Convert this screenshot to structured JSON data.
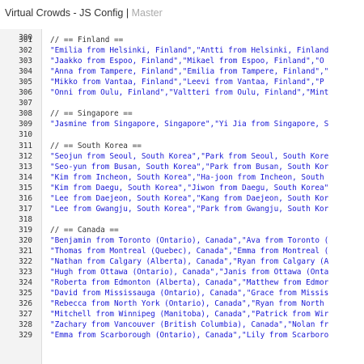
{
  "window": {
    "title": "Virtual Crowds - JS Config",
    "separator": "|",
    "branch": "Master"
  },
  "editor": {
    "partial_line_number": "300",
    "lines": [
      {
        "n": "301",
        "text": "// == Finland ==",
        "kind": "comment"
      },
      {
        "n": "302",
        "text": "\"Emilia from Helsinki, Finland\",\"Antti from Helsinki, Finland",
        "kind": "string"
      },
      {
        "n": "303",
        "text": "\"Jaakko from Espoo, Finland\",\"Mikael from Espoo, Finland\",\"O",
        "kind": "string"
      },
      {
        "n": "304",
        "text": "\"Anna from Tampere, Finland\",\"Emilia from Tampere, Finland\",\"",
        "kind": "string"
      },
      {
        "n": "305",
        "text": "\"Mikko from Vantaa, Finland\",\"Leevi from Vantaa, Finland\",\"P",
        "kind": "string"
      },
      {
        "n": "306",
        "text": "\"Onni from Oulu, Finland\",\"Valtteri from Oulu, Finland\",\"Mint",
        "kind": "string"
      },
      {
        "n": "307",
        "text": "",
        "kind": "blank"
      },
      {
        "n": "308",
        "text": "// == Singapore ==",
        "kind": "comment"
      },
      {
        "n": "309",
        "text": "\"Jasmine from Singapore, Singapore\",\"Yi Jia from Singapore, S",
        "kind": "string"
      },
      {
        "n": "310",
        "text": "",
        "kind": "blank"
      },
      {
        "n": "311",
        "text": "// == South Korea ==",
        "kind": "comment"
      },
      {
        "n": "312",
        "text": "\"Seojun from Seoul, South Korea\",\"Park from Seoul, South Kore",
        "kind": "string"
      },
      {
        "n": "313",
        "text": "\"Seo-yun from Busan, South Korea\",\"Park from Busan, South Kor",
        "kind": "string"
      },
      {
        "n": "314",
        "text": "\"Kim from Incheon, South Korea\",\"Ha-joon from Incheon, South",
        "kind": "string"
      },
      {
        "n": "315",
        "text": "\"Kim from Daegu, South Korea\",\"Jiwon from Daegu, South Korea\"",
        "kind": "string"
      },
      {
        "n": "316",
        "text": "\"Lee from Daejeon, South Korea\",\"Kang from Daejeon, South Kor",
        "kind": "string"
      },
      {
        "n": "317",
        "text": "\"Lee from Gwangju, South Korea\",\"Park from Gwangju, South Kor",
        "kind": "string"
      },
      {
        "n": "318",
        "text": "",
        "kind": "blank"
      },
      {
        "n": "319",
        "text": "// == Canada ==",
        "kind": "comment"
      },
      {
        "n": "320",
        "text": "\"Benjamin from Toronto (Ontario), Canada\",\"Ava from Toronto (",
        "kind": "string"
      },
      {
        "n": "321",
        "text": "\"Thomas from Montreal (Quebec), Canada\",\"Emma from Montreal (",
        "kind": "string"
      },
      {
        "n": "322",
        "text": "\"Nathan from Calgary (Alberta), Canada\",\"Ryan from Calgary (A",
        "kind": "string"
      },
      {
        "n": "323",
        "text": "\"Hugh from Ottawa (Ontario), Canada\",\"Janis from Ottawa (Onta",
        "kind": "string"
      },
      {
        "n": "324",
        "text": "\"Roberta from Edmonton (Alberta), Canada\",\"Matthew from Edmor",
        "kind": "string"
      },
      {
        "n": "325",
        "text": "\"David from Mississauga (Ontario), Canada\",\"Grace from Missis",
        "kind": "string"
      },
      {
        "n": "326",
        "text": "\"Rebecca from North York (Ontario), Canada\",\"Ryan from North",
        "kind": "string"
      },
      {
        "n": "327",
        "text": "\"Mitchell from Winnipeg (Manitoba), Canada\",\"Patrick from Wir",
        "kind": "string"
      },
      {
        "n": "328",
        "text": "\"Zachary from Vancouver (British Columbia), Canada\",\"Nolan fr",
        "kind": "string"
      },
      {
        "n": "329",
        "text": "\"Emma from Scarborough (Ontario), Canada\",\"Lily from Scarboro",
        "kind": "string"
      }
    ]
  },
  "colors": {
    "string": "#1a1ad6",
    "comment": "#333333",
    "line_number": "#333333",
    "gutter_bg": "#f3f3f3",
    "branch": "#aaaaaa"
  }
}
